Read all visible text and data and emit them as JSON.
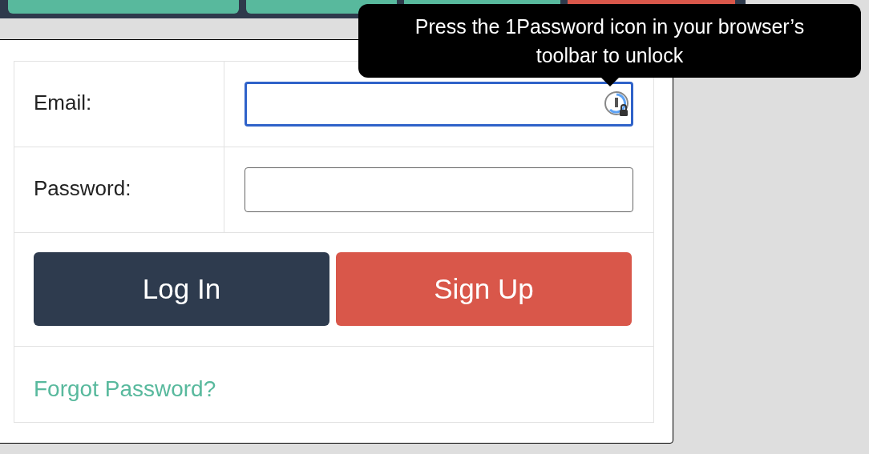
{
  "nav_buttons": [
    {
      "color": "#58b99d"
    },
    {
      "color": "#58b99d"
    },
    {
      "color": "#58b99d"
    },
    {
      "color": "#d9574a"
    }
  ],
  "form": {
    "fields": [
      {
        "label": "Email:",
        "focused": true,
        "password_manager": true
      },
      {
        "label": "Password:",
        "focused": false,
        "password_manager": false
      }
    ],
    "buttons": [
      {
        "label": "Log In",
        "kind": "primary"
      },
      {
        "label": "Sign Up",
        "kind": "danger"
      }
    ],
    "link": "Forgot Password?"
  },
  "tooltip": {
    "text": "Press the 1Password icon in your browser’s toolbar to unlock"
  }
}
